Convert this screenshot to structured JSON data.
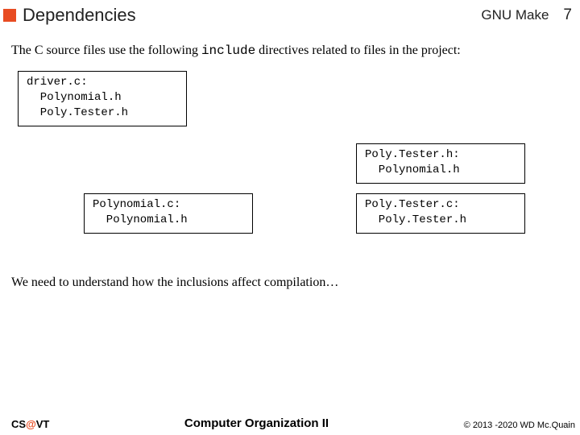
{
  "header": {
    "title": "Dependencies",
    "topic": "GNU Make",
    "page": "7"
  },
  "intro": {
    "pre": "The C source files use the following ",
    "code": "include",
    "post": " directives related to files in the project:"
  },
  "boxes": {
    "b1": "driver.c:\n  Polynomial.h\n  Poly.Tester.h",
    "b2": "Poly.Tester.h:\n  Polynomial.h",
    "b3": "Polynomial.c:\n  Polynomial.h",
    "b4": "Poly.Tester.c:\n  Poly.Tester.h"
  },
  "closing": "We need to understand how the inclusions affect compilation…",
  "footer": {
    "org_cs": "CS",
    "org_at": "@",
    "org_vt": "VT",
    "center": "Computer Organization II",
    "right": "© 2013 -2020 WD Mc.Quain"
  },
  "colors": {
    "accent": "#e84c22"
  }
}
